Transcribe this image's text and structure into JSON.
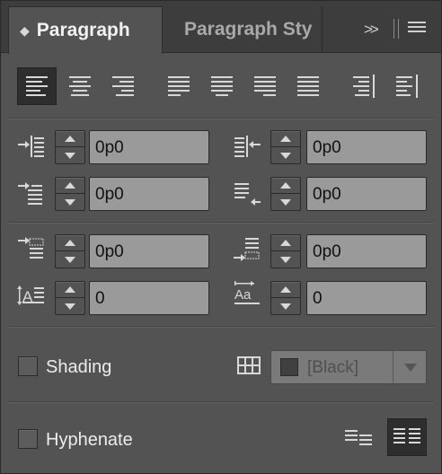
{
  "tabs": [
    {
      "label": "Paragraph",
      "active": true,
      "icon": "chevron-updown-icon"
    },
    {
      "label": "Paragraph Sty",
      "active": false
    }
  ],
  "tab_controls": {
    "expand_icon": "double-chevron-right-icon",
    "menu_icon": "hamburger-menu-icon",
    "expand_glyph": ">>"
  },
  "alignment_buttons": [
    {
      "name": "align-left",
      "active": true
    },
    {
      "name": "align-center",
      "active": false
    },
    {
      "name": "align-right",
      "active": false
    },
    {
      "name": "justify-last-left",
      "active": false
    },
    {
      "name": "justify-last-center",
      "active": false
    },
    {
      "name": "justify-last-right",
      "active": false
    },
    {
      "name": "justify-all",
      "active": false
    },
    {
      "name": "align-towards-spine",
      "active": false
    },
    {
      "name": "align-away-from-spine",
      "active": false
    }
  ],
  "indents": {
    "left_indent": "0p0",
    "right_indent": "0p0",
    "first_line_indent": "0p0",
    "last_line_right_indent": "0p0"
  },
  "spacing": {
    "space_before": "0p0",
    "space_after": "0p0",
    "drop_cap_lines": "0",
    "drop_cap_characters": "0"
  },
  "shading": {
    "label": "Shading",
    "checked": false,
    "color_value": "[Black]",
    "color_swatch": "#404040"
  },
  "hyphenate": {
    "label": "Hyphenate",
    "checked": false
  },
  "colors": {
    "panel_bg": "#535353",
    "field_bg": "#9a9a9a",
    "active_btn_bg": "#2e2e2e",
    "tabbar_bg": "#3d3d3d"
  }
}
